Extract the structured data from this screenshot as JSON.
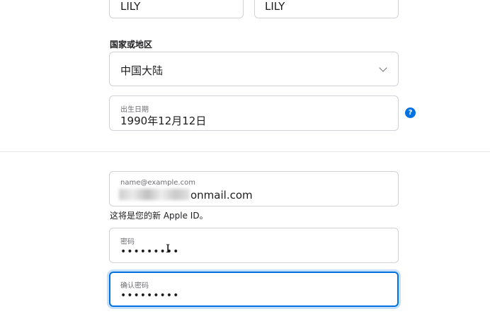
{
  "name": {
    "first_value": "LILY",
    "last_value": "LILY"
  },
  "country": {
    "label": "国家或地区",
    "value": "中国大陆"
  },
  "birthday": {
    "label": "出生日期",
    "value": "1990年12月12日",
    "help_icon": "?"
  },
  "apple_id": {
    "placeholder": "name@example.com",
    "value_suffix": "onmail.com",
    "hint": "这将是您的新 Apple ID。"
  },
  "password": {
    "label": "密码",
    "value": "•••••••••"
  },
  "confirm_password": {
    "label": "确认密码",
    "value": "•••••••••"
  },
  "colors": {
    "accent": "#0071e3",
    "border": "#d2d2d7",
    "text": "#1d1d1f",
    "muted": "#6e6e73"
  }
}
